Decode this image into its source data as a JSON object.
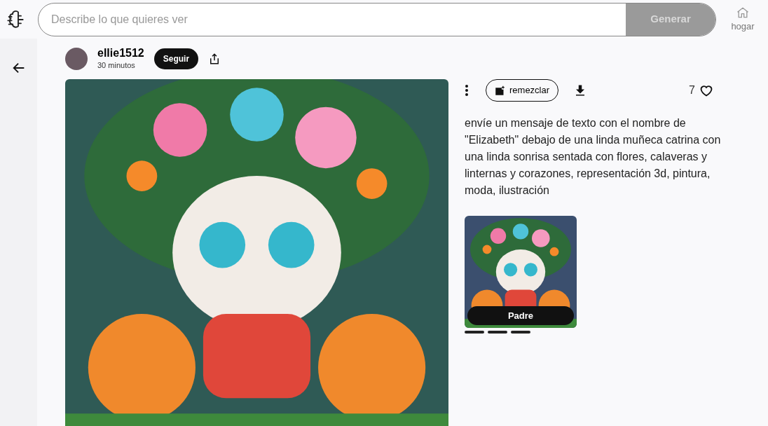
{
  "search": {
    "placeholder": "Describe lo que quieres ver",
    "button": "Generar"
  },
  "nav": {
    "home": "hogar"
  },
  "post": {
    "user": "ellie1512",
    "time": "30 minutos",
    "follow": "Seguir",
    "remix": "remezclar",
    "likes": "7",
    "prompt": "envíe un mensaje de texto con el nombre de \"Elizabeth\" debajo de una linda muñeca catrina con una linda sonrisa sentada con flores, calaveras y linternas y corazones, representación 3d, pintura, moda, ilustración",
    "parent_label": "Padre"
  }
}
